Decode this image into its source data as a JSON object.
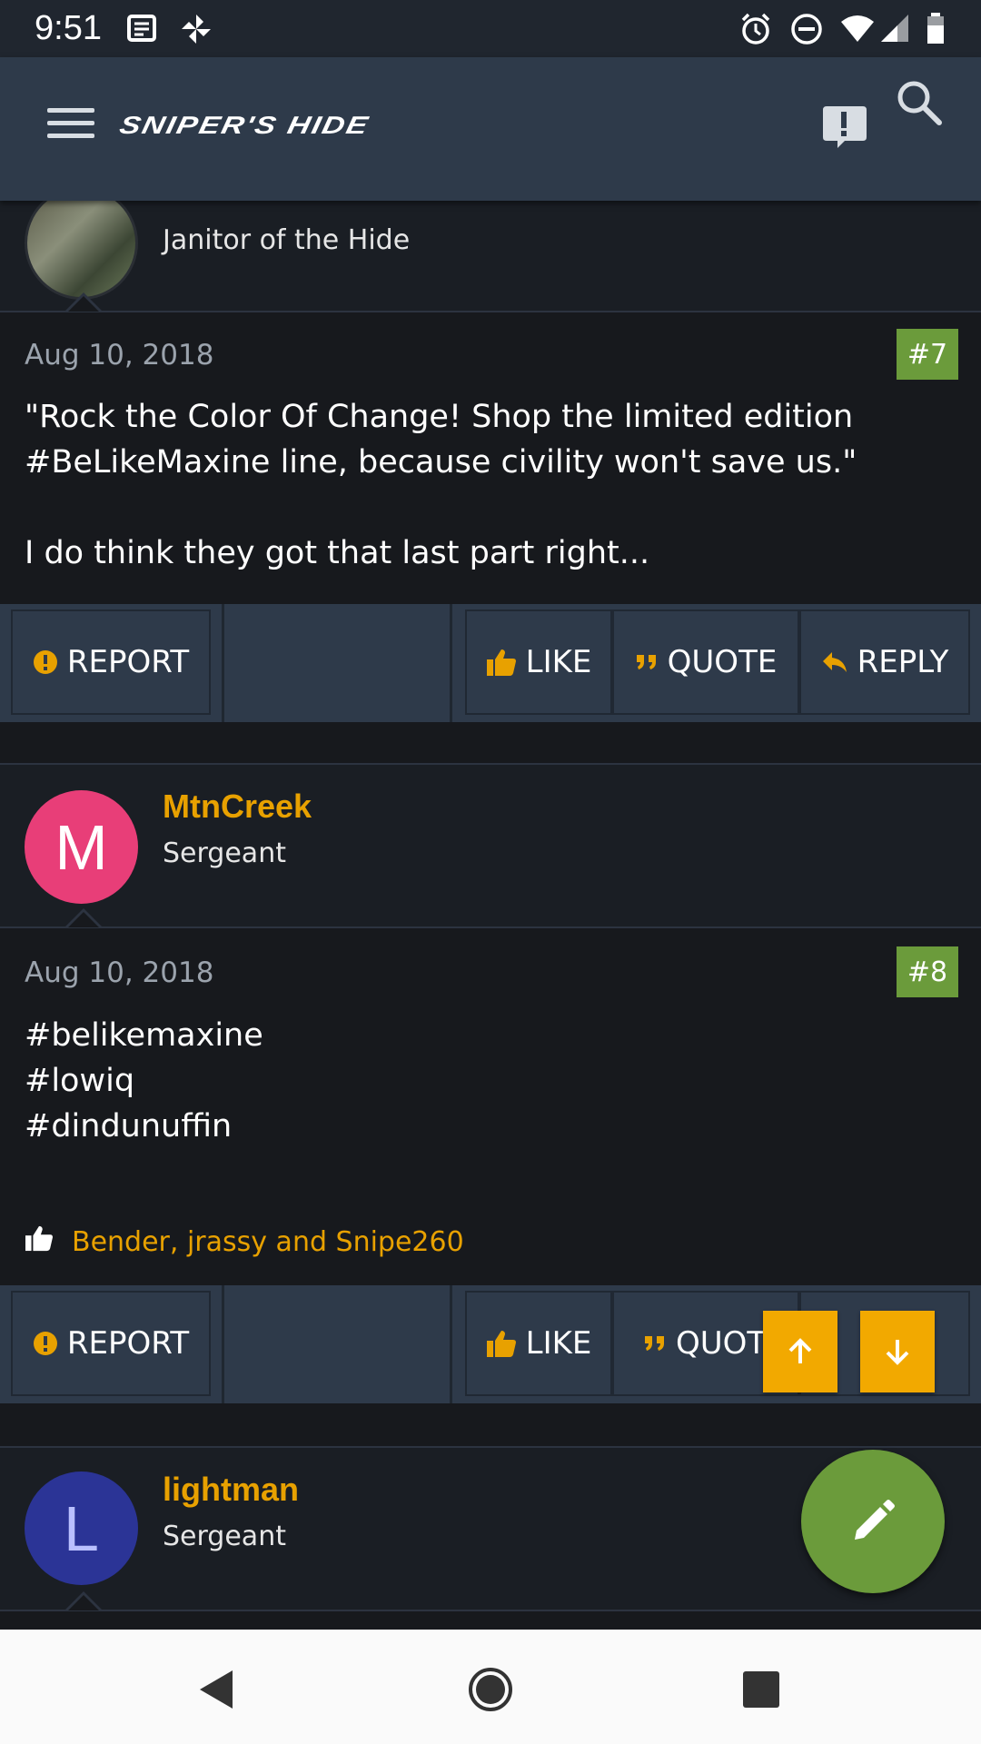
{
  "status_bar": {
    "time": "9:51"
  },
  "header": {
    "logo_text": "SNIPER'S HIDE"
  },
  "posts": [
    {
      "author_title": "Janitor of the Hide",
      "date": "Aug 10, 2018",
      "number": "#7",
      "body": "\"Rock the Color Of Change! Shop the limited edition\n#BeLikeMaxine line, because civility won't save us.\"\n\nI do think they got that last part right..."
    },
    {
      "author": "MtnCreek",
      "author_title": "Sergeant",
      "avatar_letter": "M",
      "avatar_color": "#e83e78",
      "date": "Aug 10, 2018",
      "number": "#8",
      "body": "#belikemaxine\n#lowiq\n#dindunuffin",
      "likers": "Bender, jrassy and Snipe260"
    },
    {
      "author": "lightman",
      "author_title": "Sergeant",
      "avatar_letter": "L",
      "avatar_color": "#2b3496"
    }
  ],
  "actions": {
    "report": "REPORT",
    "like": "LIKE",
    "quote": "QUOTE",
    "quote_partial": "QUOT",
    "reply": "REPLY"
  },
  "colors": {
    "accent": "#e8a100",
    "post_number_bg": "#6b9b3b",
    "header_bg": "#2e3a4a",
    "background": "#17191d"
  },
  "icons": [
    "menu-icon",
    "alert-icon",
    "search-icon",
    "warning-icon",
    "thumbs-up-icon",
    "quote-icon",
    "reply-icon",
    "arrow-up-icon",
    "arrow-down-icon",
    "pencil-icon",
    "back-icon",
    "home-icon",
    "recents-icon"
  ]
}
